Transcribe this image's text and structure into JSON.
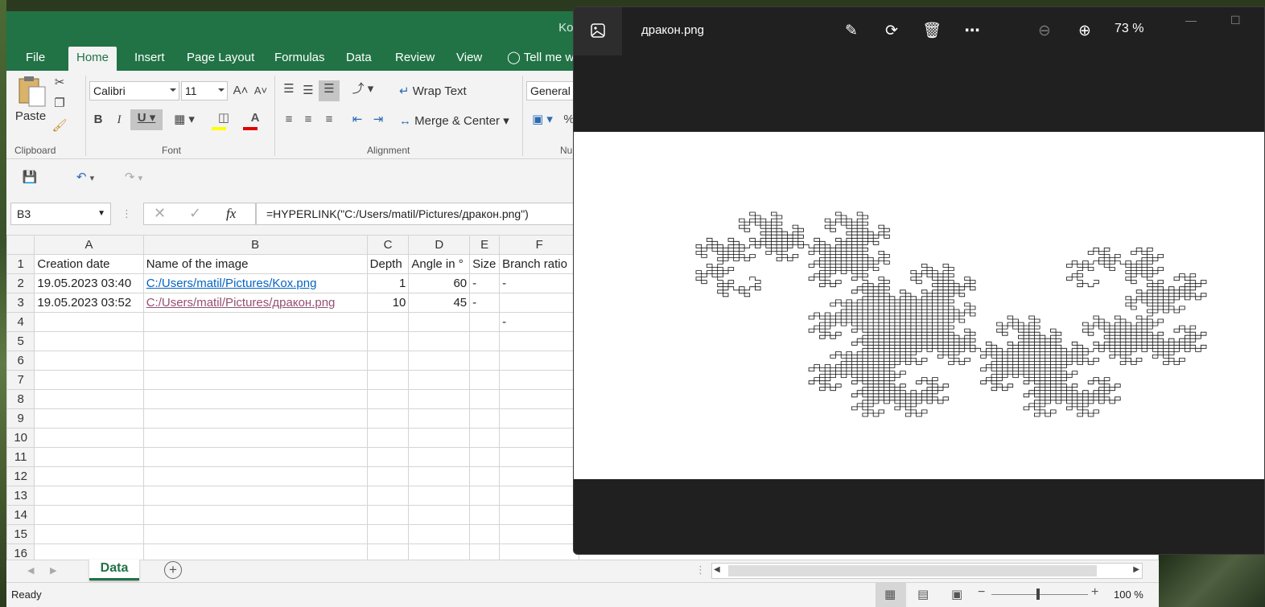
{
  "excel": {
    "title_fragment": "Kox",
    "tabs": [
      "File",
      "Home",
      "Insert",
      "Page Layout",
      "Formulas",
      "Data",
      "Review",
      "View",
      "Tell me w"
    ],
    "active_tab": "Home",
    "ribbon": {
      "paste_label": "Paste",
      "font_name": "Calibri",
      "font_size": "11",
      "wrap_text": "Wrap Text",
      "merge_center": "Merge & Center",
      "number_format": "General",
      "groups": {
        "clipboard": "Clipboard",
        "font": "Font",
        "alignment": "Alignment",
        "number": "Nu"
      }
    },
    "name_box": "B3",
    "formula": "=HYPERLINK(\"C:/Users/matil/Pictures/дракон.png\")",
    "columns": [
      "A",
      "B",
      "C",
      "D",
      "E",
      "F"
    ],
    "rows": [
      {
        "n": "1",
        "a": "Creation date",
        "b": "Name of the image",
        "c": "Depth",
        "d": "Angle in °",
        "e": "Size",
        "f": "Branch ratio"
      },
      {
        "n": "2",
        "a": "19.05.2023 03:40",
        "b": "C:/Users/matil/Pictures/Kox.png",
        "c": "1",
        "d": "60",
        "e": "-",
        "f": "-"
      },
      {
        "n": "3",
        "a": "19.05.2023 03:52",
        "b": "C:/Users/matil/Pictures/дракон.png",
        "c": "10",
        "d": "45",
        "e": "-",
        "f": ""
      },
      {
        "n": "4",
        "a": "",
        "b": "",
        "c": "",
        "d": "",
        "e": "",
        "f": "-"
      },
      {
        "n": "5"
      },
      {
        "n": "6"
      },
      {
        "n": "7"
      },
      {
        "n": "8"
      },
      {
        "n": "9"
      },
      {
        "n": "10"
      },
      {
        "n": "11"
      },
      {
        "n": "12"
      },
      {
        "n": "13"
      },
      {
        "n": "14"
      },
      {
        "n": "15"
      },
      {
        "n": "16"
      }
    ],
    "sheet_tab": "Data",
    "status": "Ready",
    "zoom": "100 %"
  },
  "viewer": {
    "filename": "дракон.png",
    "zoom": "73 %",
    "icons": [
      "edit-image-icon",
      "rotate-icon",
      "delete-icon",
      "more-icon",
      "zoom-out-icon",
      "zoom-in-icon"
    ]
  }
}
